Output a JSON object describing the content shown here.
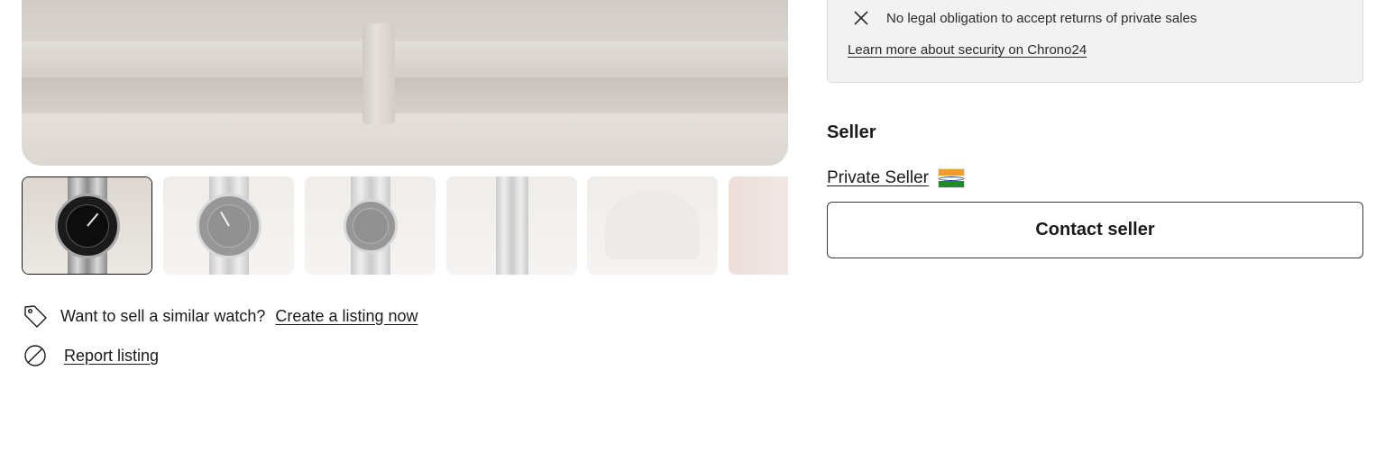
{
  "gallery": {
    "thumbnails": [
      {
        "label": "Photo 1",
        "active": true
      },
      {
        "label": "Photo 2",
        "active": false
      },
      {
        "label": "Photo 3",
        "active": false
      },
      {
        "label": "Photo 4",
        "active": false
      },
      {
        "label": "Photo 5",
        "active": false
      },
      {
        "label": "Photo 6",
        "active": false
      }
    ]
  },
  "actions": {
    "sell_prompt": "Want to sell a similar watch?",
    "sell_link": "Create a listing now",
    "report_link": "Report listing"
  },
  "security": {
    "no_returns_text": "No legal obligation to accept returns of private sales",
    "learn_more_link": "Learn more about security on Chrono24"
  },
  "seller": {
    "heading": "Seller",
    "name": "Private Seller",
    "flag": "india-flag",
    "contact_button": "Contact seller"
  },
  "icons": {
    "close": "close-icon",
    "tag": "tag-icon",
    "report": "prohibited-icon"
  },
  "colors": {
    "text": "#1a1a1a",
    "panel_bg": "#f2f2f2",
    "border": "#3a3a3a"
  }
}
